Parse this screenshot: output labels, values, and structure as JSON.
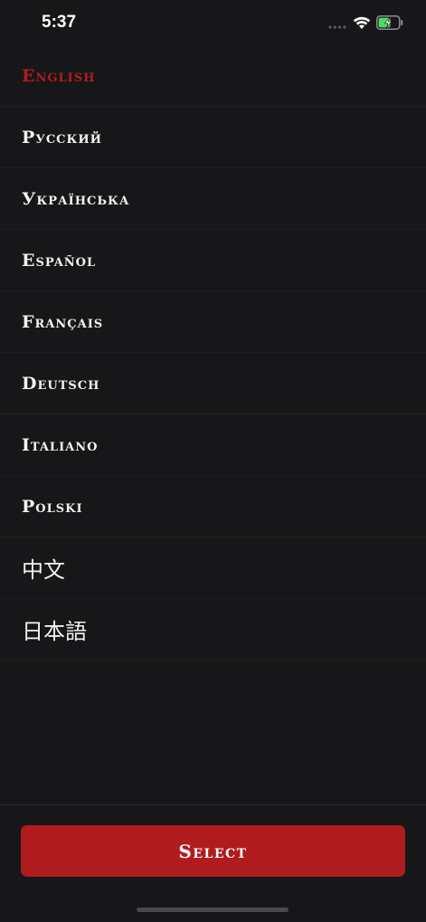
{
  "status_bar": {
    "time": "5:37",
    "icons": [
      "signal-dots-icon",
      "wifi-icon",
      "battery-charging-icon"
    ]
  },
  "languages": [
    {
      "label": "English",
      "selected": true
    },
    {
      "label": "Русский",
      "selected": false
    },
    {
      "label": "Українська",
      "selected": false
    },
    {
      "label": "Español",
      "selected": false
    },
    {
      "label": "Français",
      "selected": false
    },
    {
      "label": "Deutsch",
      "selected": false
    },
    {
      "label": "Italiano",
      "selected": false
    },
    {
      "label": "Polski",
      "selected": false
    },
    {
      "label": "中文",
      "selected": false
    },
    {
      "label": "日本語",
      "selected": false
    }
  ],
  "select_button": {
    "label": "Select"
  },
  "colors": {
    "background": "#171719",
    "accent": "#b01c1d",
    "text": "#f2f2f2"
  }
}
